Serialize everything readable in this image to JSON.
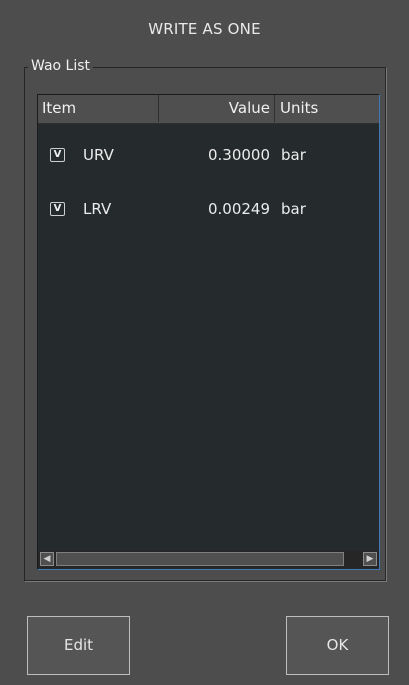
{
  "dialog": {
    "title": "WRITE AS ONE"
  },
  "group": {
    "label": "Wao List"
  },
  "list": {
    "columns": [
      "Item",
      "Value",
      "Units"
    ],
    "rows": [
      {
        "checked": true,
        "check_label": "V",
        "item": "URV",
        "value": "0.30000",
        "units": "bar"
      },
      {
        "checked": true,
        "check_label": "V",
        "item": "LRV",
        "value": "0.00249",
        "units": "bar"
      }
    ]
  },
  "buttons": {
    "edit": "Edit",
    "ok": "OK"
  }
}
